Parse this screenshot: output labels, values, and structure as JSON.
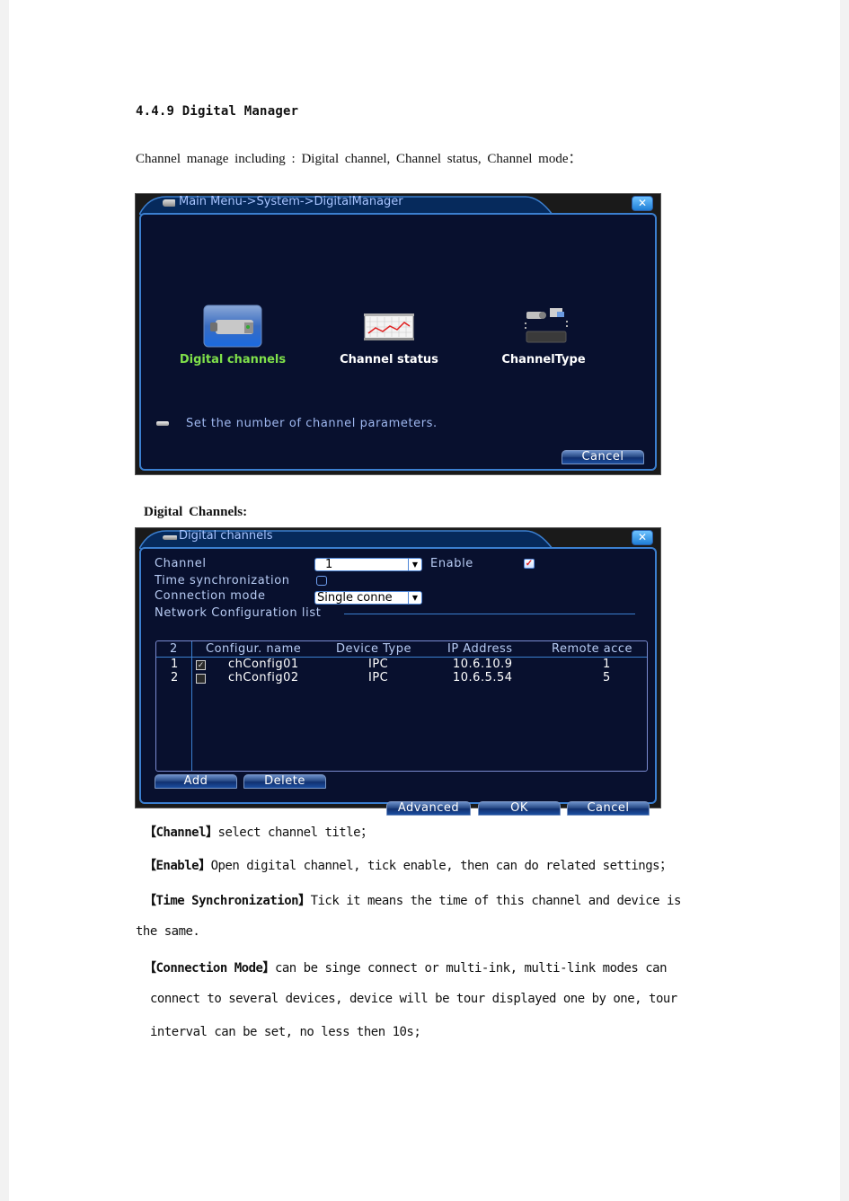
{
  "document": {
    "heading": "4.4.9 Digital Manager",
    "intro": "Channel manage including : Digital channel, Channel status, Channel mode：",
    "subheading": "Digital Channels:"
  },
  "window_main": {
    "title": "Main Menu->System->DigitalManager",
    "close_icon": "close-icon",
    "items": [
      {
        "label": "Digital channels",
        "icon": "ip-camera-icon",
        "active": true
      },
      {
        "label": "Channel status",
        "icon": "line-chart-icon",
        "active": false
      },
      {
        "label": "ChannelType",
        "icon": "camera-recorder-icon",
        "active": false
      }
    ],
    "hint": "Set the number of channel parameters.",
    "cancel_label": "Cancel"
  },
  "window_channels": {
    "title": "Digital channels",
    "channel_label": "Channel",
    "channel_value": "1",
    "enable_label": "Enable",
    "enable_checked": true,
    "time_sync_label": "Time synchronization",
    "time_sync_checked": false,
    "connection_mode_label": "Connection mode",
    "connection_mode_value": "Single conne",
    "network_list_label": "Network Configuration list",
    "table": {
      "columns": [
        "2",
        "Configur. name",
        "Device Type",
        "IP Address",
        "Remote acce"
      ],
      "rows": [
        {
          "index": "1",
          "checked": true,
          "name": "chConfig01",
          "type": "IPC",
          "ip": "10.6.10.9",
          "remote": "1"
        },
        {
          "index": "2",
          "checked": false,
          "name": "chConfig02",
          "type": "IPC",
          "ip": "10.6.5.54",
          "remote": "5"
        }
      ]
    },
    "buttons": {
      "add": "Add",
      "delete": "Delete",
      "advanced": "Advanced",
      "ok": "OK",
      "cancel": "Cancel"
    }
  },
  "descriptions": [
    {
      "key": "【Channel】",
      "text": "select channel title；"
    },
    {
      "key": "【Enable】",
      "text": "Open digital channel, tick enable, then can do related settings；"
    },
    {
      "key": "【Time Synchronization】",
      "text": "Tick it means the time of this channel and device is",
      "cont": "the same."
    },
    {
      "key": "【Connection Mode】",
      "text": "can be singe connect or multi-ink, multi-link modes can",
      "cont": "connect to several devices, device will be tour displayed one by one, tour",
      "cont2": "interval can be set, no less then 10s;"
    }
  ]
}
